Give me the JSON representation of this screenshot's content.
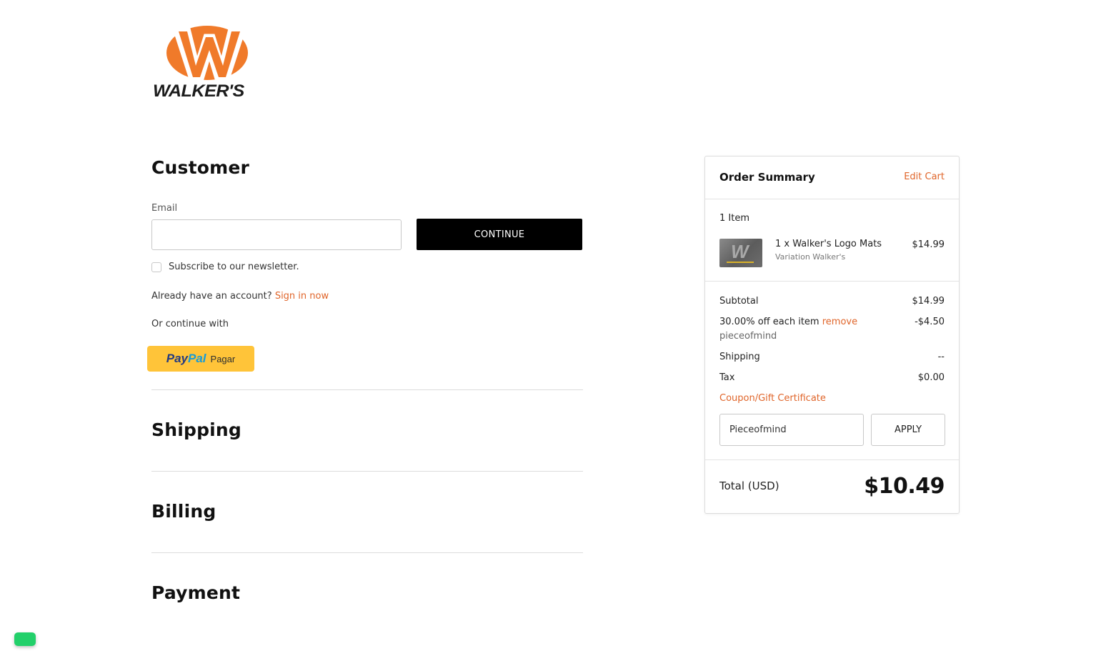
{
  "brand": {
    "name": "WALKER'S",
    "primary_color": "#e0652a",
    "logo_orange": "#f07a2a"
  },
  "customer": {
    "title": "Customer",
    "email_label": "Email",
    "email_value": "",
    "continue_label": "CONTINUE",
    "newsletter_label": "Subscribe to our newsletter.",
    "newsletter_checked": false,
    "account_prompt": "Already have an account?",
    "sign_in_label": "Sign in now",
    "or_continue": "Or continue with",
    "paypal": {
      "pay": "Pay",
      "pal": "Pal",
      "action": "Pagar"
    }
  },
  "sections": {
    "shipping": "Shipping",
    "billing": "Billing",
    "payment": "Payment"
  },
  "summary": {
    "title": "Order Summary",
    "edit_cart": "Edit Cart",
    "item_count": "1 Item",
    "item": {
      "name": "1 x Walker's Logo Mats",
      "variation": "Variation Walker's",
      "price": "$14.99"
    },
    "subtotal_label": "Subtotal",
    "subtotal_value": "$14.99",
    "discount_label": "30.00% off each item",
    "discount_remove": "remove",
    "discount_code": "pieceofmind",
    "discount_value": "-$4.50",
    "shipping_label": "Shipping",
    "shipping_value": "--",
    "tax_label": "Tax",
    "tax_value": "$0.00",
    "coupon_link": "Coupon/Gift Certificate",
    "coupon_value": "Pieceofmind",
    "apply_label": "APPLY",
    "total_label": "Total (USD)",
    "total_value": "$10.49"
  },
  "chat": {
    "color": "#22d06a"
  }
}
